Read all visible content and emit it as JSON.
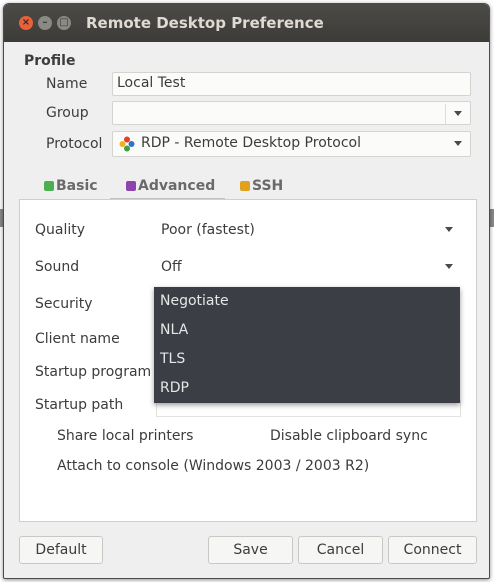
{
  "window": {
    "title": "Remote Desktop Preference"
  },
  "titlebar": {
    "close_glyph": "×",
    "min_glyph": "–",
    "max_glyph": "□"
  },
  "profile": {
    "section_title": "Profile",
    "name_label": "Name",
    "name_value": "Local Test",
    "group_label": "Group",
    "group_value": "",
    "protocol_label": "Protocol",
    "protocol_value": "RDP - Remote Desktop Protocol"
  },
  "tabs": [
    {
      "label": "Basic",
      "icon": "info-icon",
      "color": "#4caf50"
    },
    {
      "label": "Advanced",
      "icon": "exclamation-icon",
      "color": "#8e44ad"
    },
    {
      "label": "SSH",
      "icon": "lock-icon",
      "color": "#e0a020"
    }
  ],
  "advanced": {
    "quality_label": "Quality",
    "quality_value": "Poor (fastest)",
    "sound_label": "Sound",
    "sound_value": "Off",
    "security_label": "Security",
    "client_name_label": "Client name",
    "startup_program_label": "Startup program",
    "startup_path_label": "Startup path",
    "share_printers_label": "Share local printers",
    "disable_clipboard_label": "Disable clipboard sync",
    "attach_console_label": "Attach to console (Windows 2003 / 2003 R2)"
  },
  "security_dropdown": {
    "options": [
      "Negotiate",
      "NLA",
      "TLS",
      "RDP"
    ]
  },
  "buttons": {
    "default": "Default",
    "save": "Save",
    "cancel": "Cancel",
    "connect": "Connect"
  }
}
